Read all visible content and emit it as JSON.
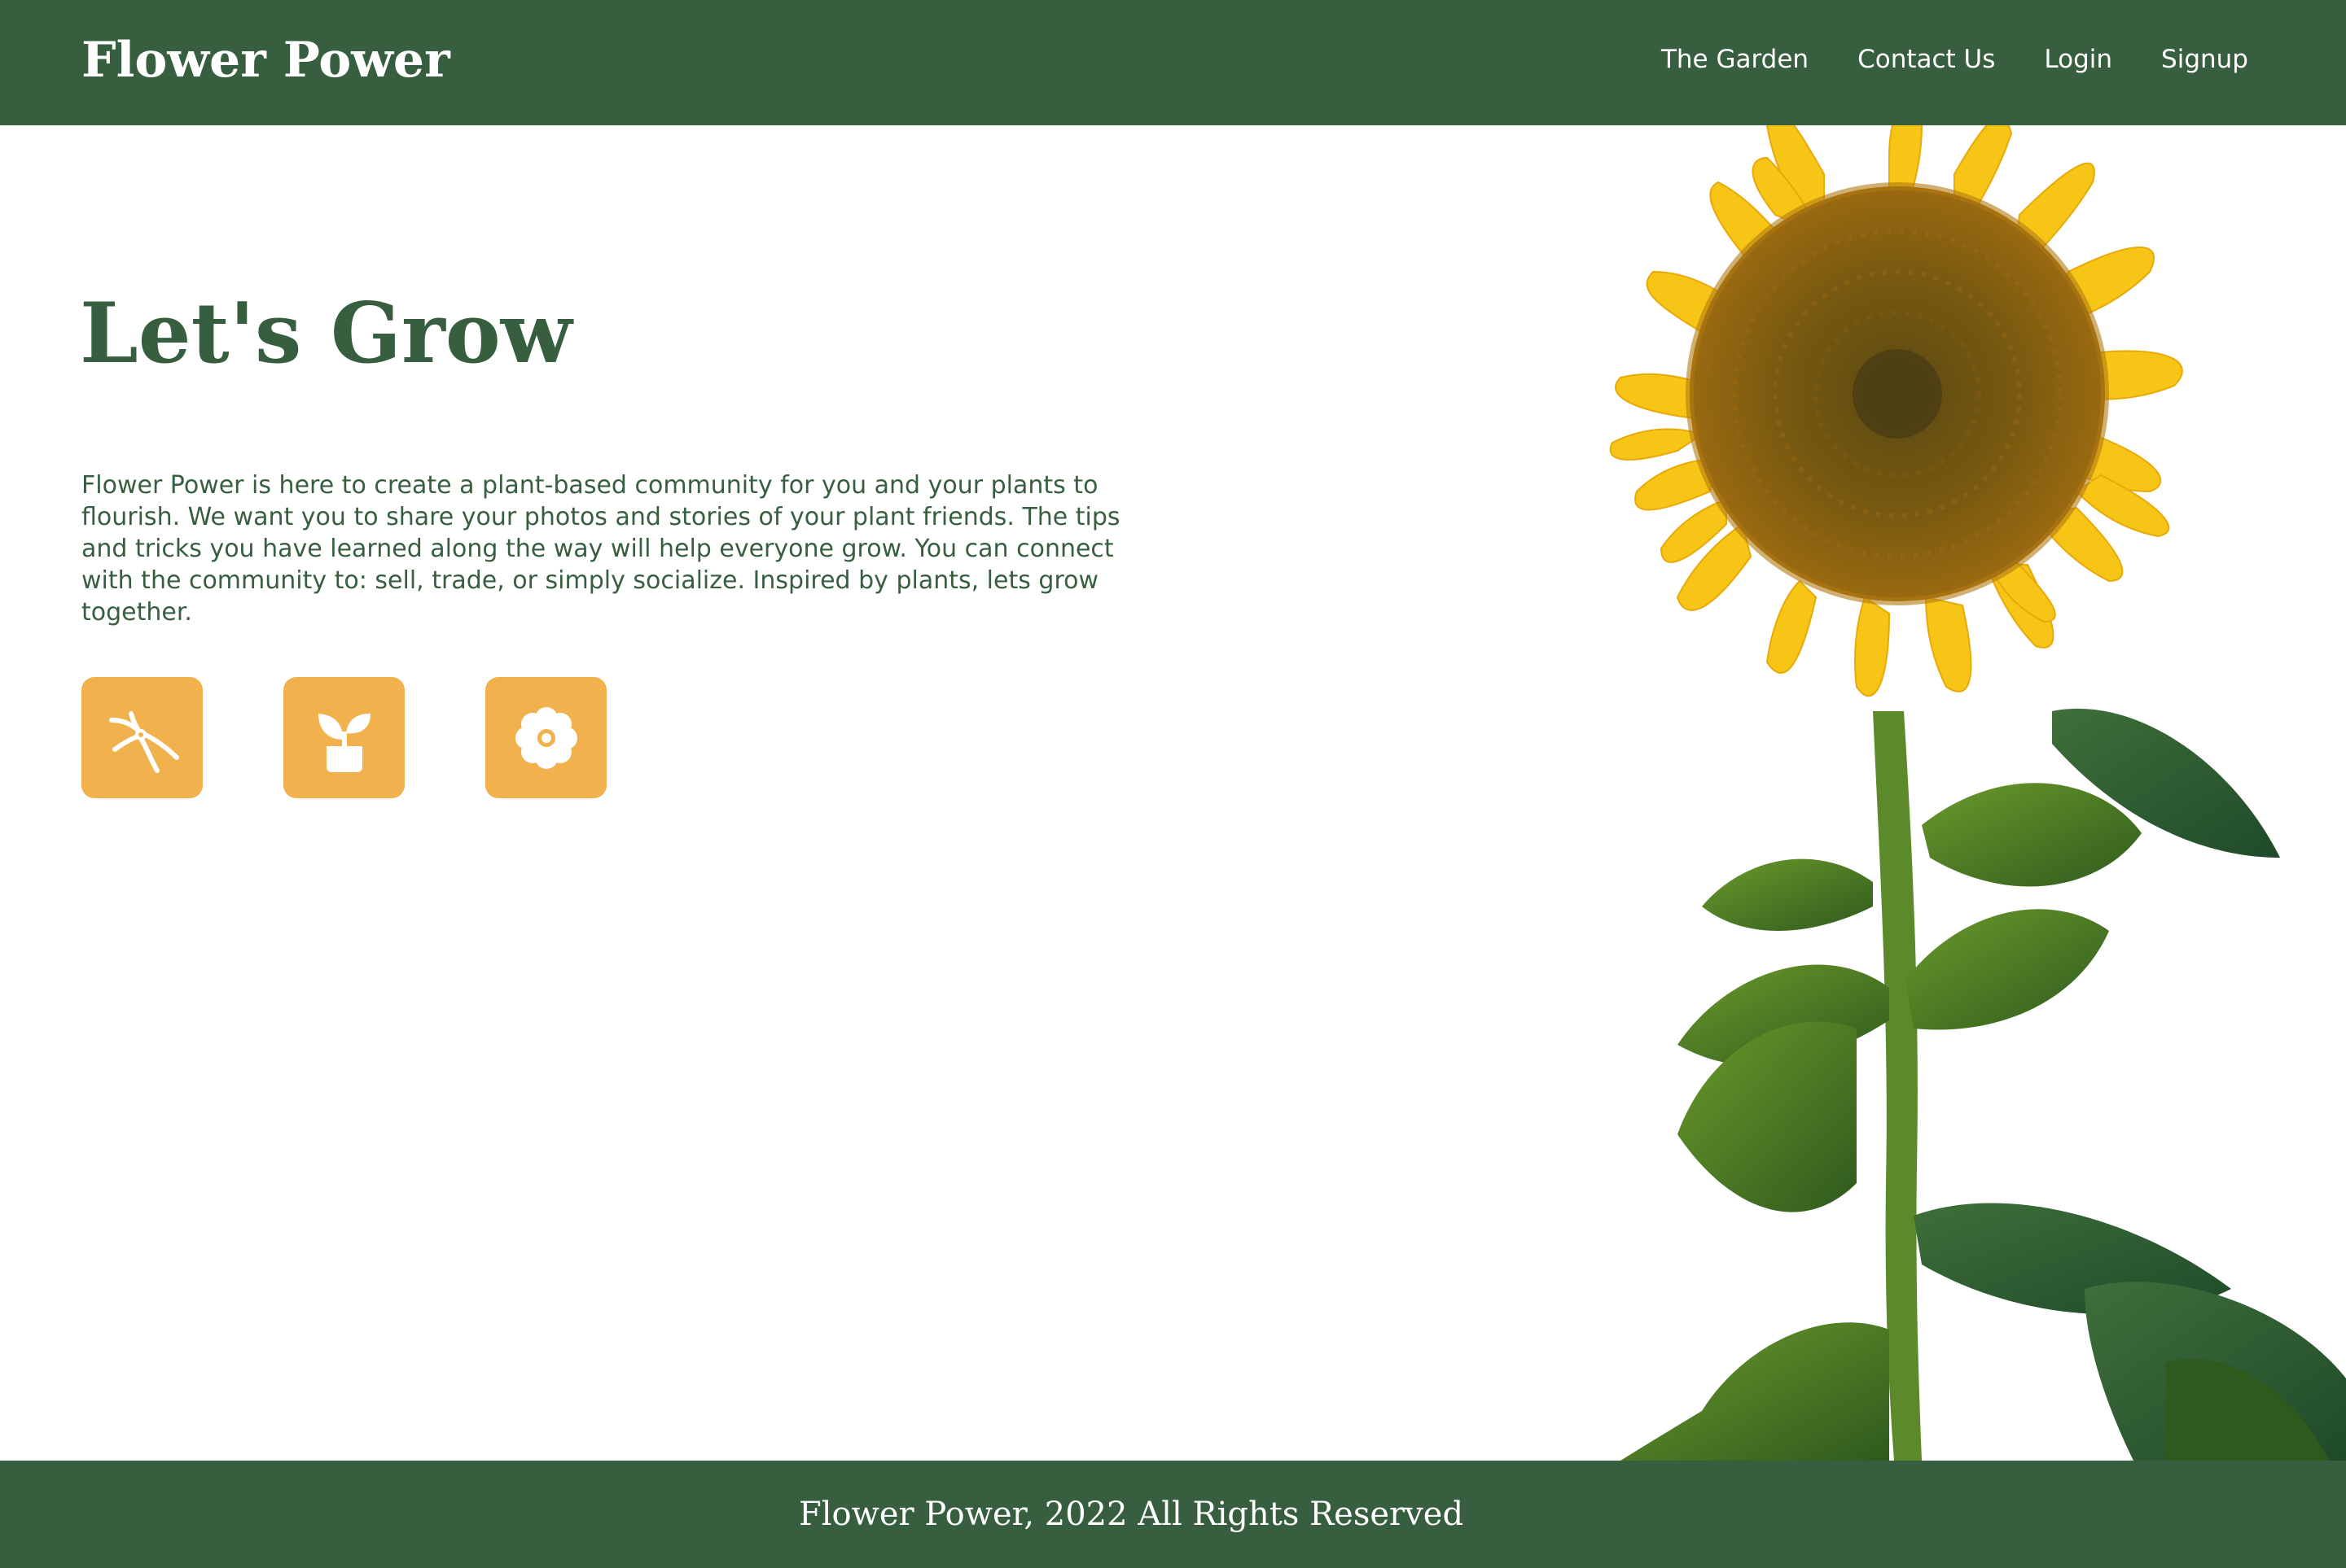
{
  "header": {
    "brand": "Flower Power",
    "nav": [
      {
        "label": "The Garden"
      },
      {
        "label": "Contact Us"
      },
      {
        "label": "Login"
      },
      {
        "label": "Signup"
      }
    ]
  },
  "hero": {
    "title": "Let's Grow",
    "description": "Flower Power is here to create a plant-based community for you and your plants to flourish. We want you to share your photos and stories of your plant friends. The tips and tricks you have learned along the way will help everyone grow. You can connect with the community to: sell, trade, or simply socialize. Inspired by plants, lets grow together.",
    "icons": [
      {
        "name": "pruning-shears-icon"
      },
      {
        "name": "potted-plant-icon"
      },
      {
        "name": "flower-icon"
      }
    ],
    "image": {
      "name": "sunflower-image"
    }
  },
  "footer": {
    "text": "Flower Power, 2022 All Rights Reserved"
  },
  "colors": {
    "primary_green": "#375f3f",
    "accent_orange": "#f1b24e",
    "background": "#ffffff",
    "header_text": "#ffffff"
  }
}
